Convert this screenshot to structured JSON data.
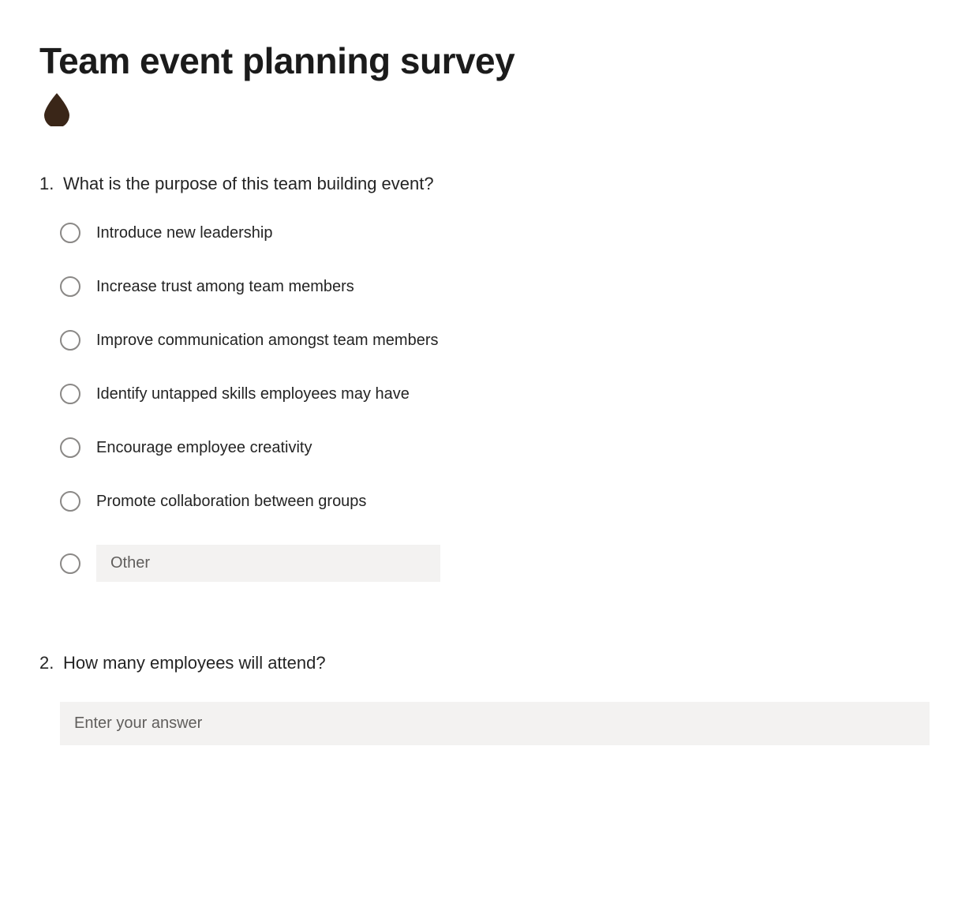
{
  "form": {
    "title": "Team event planning survey",
    "accent_color": "#3a2618",
    "questions": [
      {
        "number": "1.",
        "text": "What is the purpose of this team building event?",
        "type": "radio",
        "options": [
          "Introduce new leadership",
          "Increase trust among team members",
          "Improve communication amongst team members",
          "Identify untapped skills employees may have",
          "Encourage employee creativity",
          "Promote collaboration between groups"
        ],
        "other_placeholder": "Other"
      },
      {
        "number": "2.",
        "text": "How many employees will attend?",
        "type": "text",
        "placeholder": "Enter your answer"
      }
    ]
  }
}
